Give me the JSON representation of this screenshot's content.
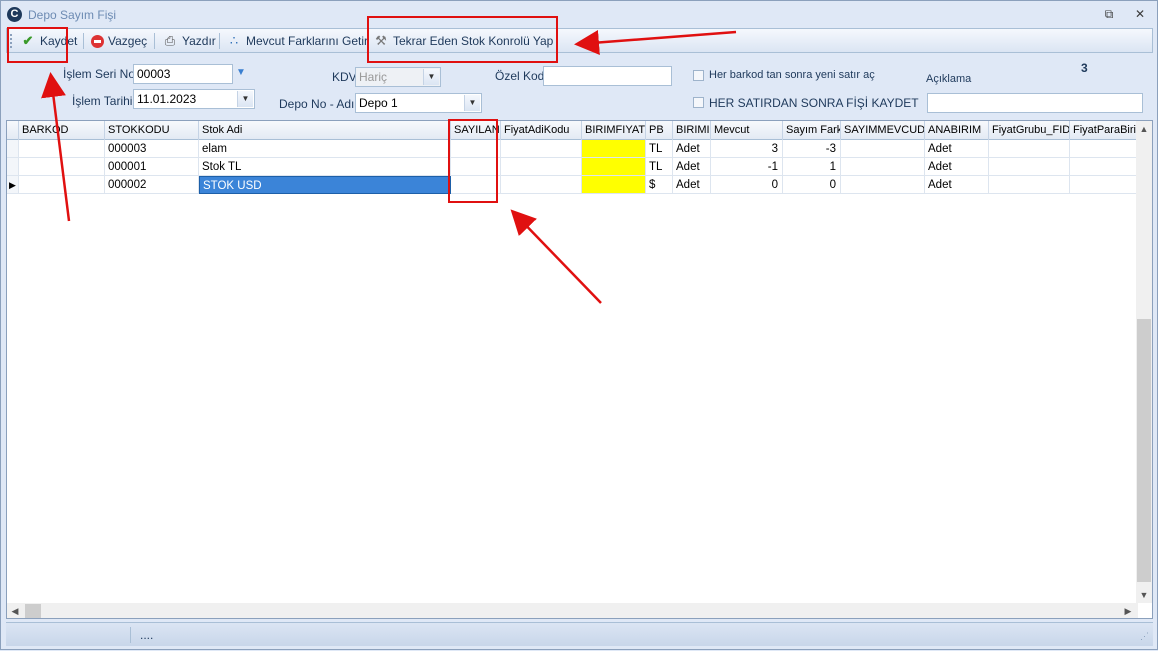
{
  "window": {
    "title": "Depo Sayım Fişi",
    "logo": "C"
  },
  "toolbar": {
    "save_label": "Kaydet",
    "cancel_label": "Vazgeç",
    "print_label": "Yazdır",
    "diff_label": "Mevcut Farklarını Getir",
    "repeat_check_label": "Tekrar Eden Stok Konrolü Yap"
  },
  "form": {
    "serial_label": "İşlem Seri No",
    "serial_value": "00003",
    "date_label": "İşlem Tarihi",
    "date_value": "11.01.2023",
    "kdv_label": "KDV",
    "kdv_value": "Hariç",
    "depot_label": "Depo No - Adı",
    "depot_value": "Depo 1",
    "special_code_label": "Özel Kod",
    "special_code_value": "",
    "opt_new_row_label": "Her barkod tan sonra yeni satır aç",
    "opt_save_each_label": "HER SATIRDAN SONRA FİŞİ KAYDET",
    "desc_label": "Açıklama",
    "desc_value": "",
    "count": "3"
  },
  "grid": {
    "columns": [
      "BARKOD",
      "STOKKODU",
      "Stok Adi",
      "SAYILAN",
      "FiyatAdiKodu",
      "BIRIMFIYAT",
      "PB",
      "BIRIMI",
      "Mevcut",
      "Sayım Farkı",
      "SAYIMMEVCUDU",
      "ANABIRIM",
      "FiyatGrubu_FID",
      "FiyatParaBirimi"
    ],
    "rows": [
      {
        "barkod": "",
        "stokkodu": "000003",
        "stokadi": "elam",
        "sayilan": "",
        "fiyatadikodu": "",
        "birimfiyat": "",
        "pb": "TL",
        "birimi": "Adet",
        "mevcut": "3",
        "fark": "-3",
        "sayimmevcudu": "",
        "anabirim": "Adet",
        "fiyatgrubu": "",
        "fiyatpara": ""
      },
      {
        "barkod": "",
        "stokkodu": "000001",
        "stokadi": "Stok TL",
        "sayilan": "",
        "fiyatadikodu": "",
        "birimfiyat": "",
        "pb": "TL",
        "birimi": "Adet",
        "mevcut": "-1",
        "fark": "1",
        "sayimmevcudu": "",
        "anabirim": "Adet",
        "fiyatgrubu": "",
        "fiyatpara": ""
      },
      {
        "barkod": "",
        "stokkodu": "000002",
        "stokadi": "STOK USD",
        "sayilan": "",
        "fiyatadikodu": "",
        "birimfiyat": "",
        "pb": "$",
        "birimi": "Adet",
        "mevcut": "0",
        "fark": "0",
        "sayimmevcudu": "",
        "anabirim": "Adet",
        "fiyatgrubu": "",
        "fiyatpara": ""
      }
    ]
  },
  "status": {
    "text": "...."
  },
  "colors": {
    "highlight": "#ffff00",
    "selection": "#3b84d8",
    "annotation": "#e01010"
  }
}
